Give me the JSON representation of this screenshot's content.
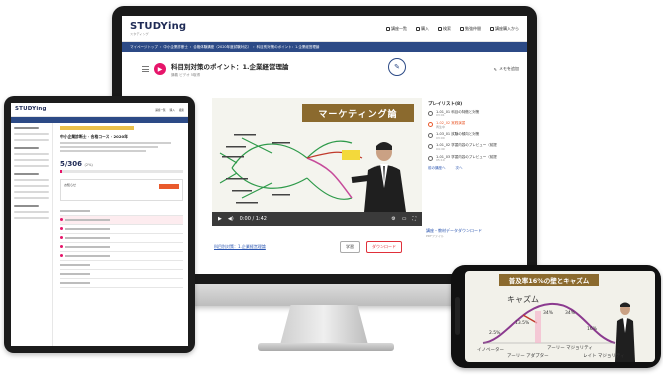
{
  "colors": {
    "brand_navy": "#1e2a55",
    "accent_orange": "#e95a2c",
    "accent_pink": "#e6156a",
    "nav_blue": "#2c4a86",
    "video_banner": "#8b6a2e"
  },
  "imac": {
    "logo": {
      "main": "STUDYing",
      "sub": "スタディング"
    },
    "nav": [
      "講座一覧",
      "購入",
      "検索",
      "勉強仲間",
      "講座購入から"
    ],
    "breadcrumb": [
      "マイページトップ",
      "中小企業診断士",
      "合格体験講座（2020年度試験対応）",
      "科目別対策のポイント：1.企業経営理論"
    ],
    "lesson_title": "科目別対策のポイント：1.企業経営理論",
    "lesson_sub": "講義  ビデオ  5取得",
    "memo_label": "メモを追加",
    "video_banner": "マーケティング論",
    "video_time": "0:00 / 1:42",
    "below_link": "科目別対策：1.企業経営理論",
    "btn_memo": "学習",
    "btn_download": "ダウンロード",
    "playlist": {
      "header": "プレイリスト(8)",
      "items": [
        {
          "title": "1-01_01 科目の特徴と対策",
          "sub": "03:01",
          "active": false
        },
        {
          "title": "1-02_02 実践演習",
          "sub": "再生中",
          "active": true
        },
        {
          "title": "1-03_01 試験の傾向と対策",
          "sub": "03:00",
          "active": false
        },
        {
          "title": "1-01_02 学習内容のプレビュー（前提",
          "sub": "04:49",
          "active": false
        },
        {
          "title": "1-01_03 学習内容のプレビュー（前提",
          "sub": "05:10",
          "active": false
        }
      ],
      "more_label": "前の講座へ",
      "next_label": "次へ"
    },
    "download_title": "講座・教材データダウンロード",
    "download_sub": "PDFファイル",
    "round_button": "学習メモ"
  },
  "ipad": {
    "logo": "STUDYing",
    "nav": [
      "講座一覧",
      "購入",
      "検索"
    ],
    "course_title": "中小企業診断士  ·  合格コース  ·  2020年",
    "progress_value": "5/306",
    "progress_pct": "(2%)",
    "progress_fraction": 0.02,
    "alert_label": "お知らせ"
  },
  "iphone": {
    "banner": "普及率16%の壁とキャズム",
    "chasm_label": "キャズム",
    "pct_labels": [
      "2.5%",
      "13.5%",
      "34%",
      "34%",
      "16%"
    ],
    "segments": [
      "イノベーター",
      "アーリー アダプター",
      "アーリー マジョリティ",
      "レイト マジョリティ"
    ]
  }
}
